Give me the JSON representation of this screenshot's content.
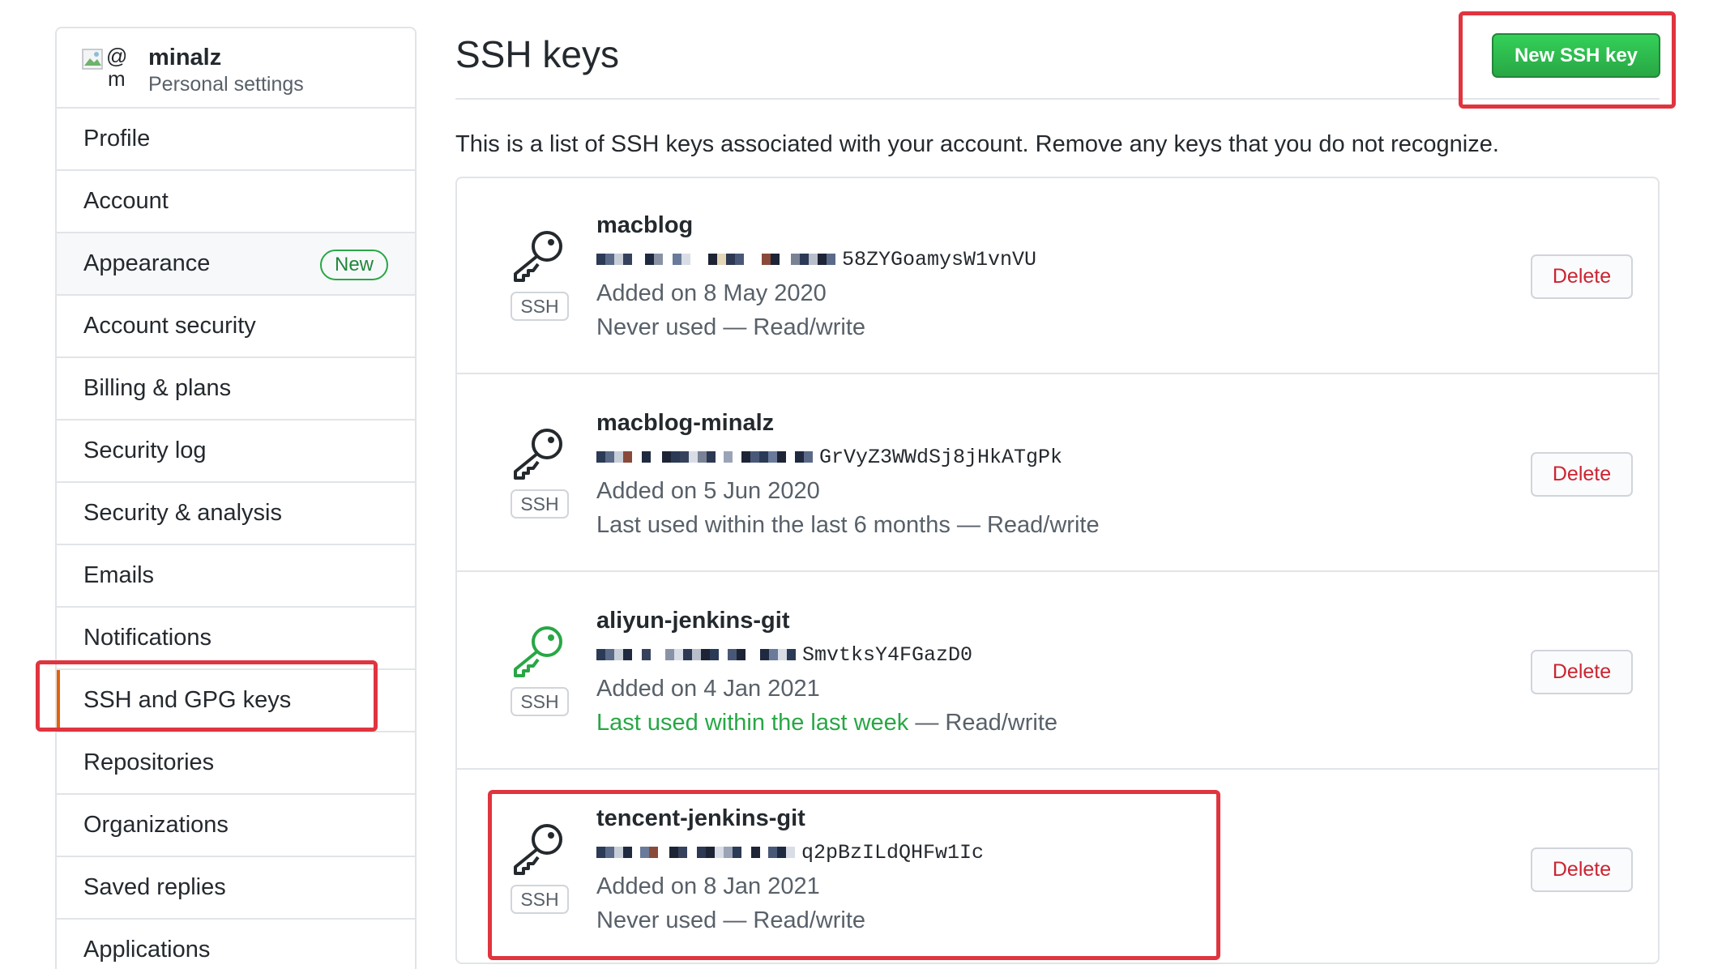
{
  "profile": {
    "username": "minalz",
    "subtitle": "Personal settings",
    "avatar_alt_line1": "@",
    "avatar_alt_line2": "m"
  },
  "sidebar": {
    "items": [
      {
        "label": "Profile"
      },
      {
        "label": "Account"
      },
      {
        "label": "Appearance",
        "badge": "New"
      },
      {
        "label": "Account security"
      },
      {
        "label": "Billing & plans"
      },
      {
        "label": "Security log"
      },
      {
        "label": "Security & analysis"
      },
      {
        "label": "Emails"
      },
      {
        "label": "Notifications"
      },
      {
        "label": "SSH and GPG keys",
        "selected": true
      },
      {
        "label": "Repositories"
      },
      {
        "label": "Organizations"
      },
      {
        "label": "Saved replies"
      },
      {
        "label": "Applications"
      }
    ]
  },
  "main": {
    "title": "SSH keys",
    "new_key_label": "New SSH key",
    "intro": "This is a list of SSH keys associated with your account. Remove any keys that you do not recognize."
  },
  "keys": [
    {
      "title": "macblog",
      "fingerprint_tail": "58ZYGoamysW1vnVU",
      "added": "Added on 8 May 2020",
      "usage_main": "Never used",
      "usage_rest": " — Read/write",
      "type_label": "SSH",
      "delete_label": "Delete",
      "icon_color": "#24292e"
    },
    {
      "title": "macblog-minalz",
      "fingerprint_tail": "GrVyZ3WWdSj8jHkATgPk",
      "added": "Added on 5 Jun 2020",
      "usage_main": "Last used within the last 6 months",
      "usage_rest": " — Read/write",
      "type_label": "SSH",
      "delete_label": "Delete",
      "icon_color": "#24292e"
    },
    {
      "title": "aliyun-jenkins-git",
      "fingerprint_tail": "SmvtksY4FGazD0",
      "added": "Added on 4 Jan 2021",
      "usage_main": "Last used within the last week",
      "usage_rest": " — Read/write",
      "type_label": "SSH",
      "delete_label": "Delete",
      "icon_color": "#28a745"
    },
    {
      "title": "tencent-jenkins-git",
      "fingerprint_tail": "q2pBzILdQHFw1Ic",
      "added": "Added on 8 Jan 2021",
      "usage_main": "Never used",
      "usage_rest": " — Read/write",
      "type_label": "SSH",
      "delete_label": "Delete",
      "icon_color": "#24292e"
    }
  ],
  "colors": {
    "primary_green": "#2ea44f",
    "danger_red": "#cb2431",
    "annotation_red": "#e0343f",
    "recent_green": "#28a745"
  }
}
